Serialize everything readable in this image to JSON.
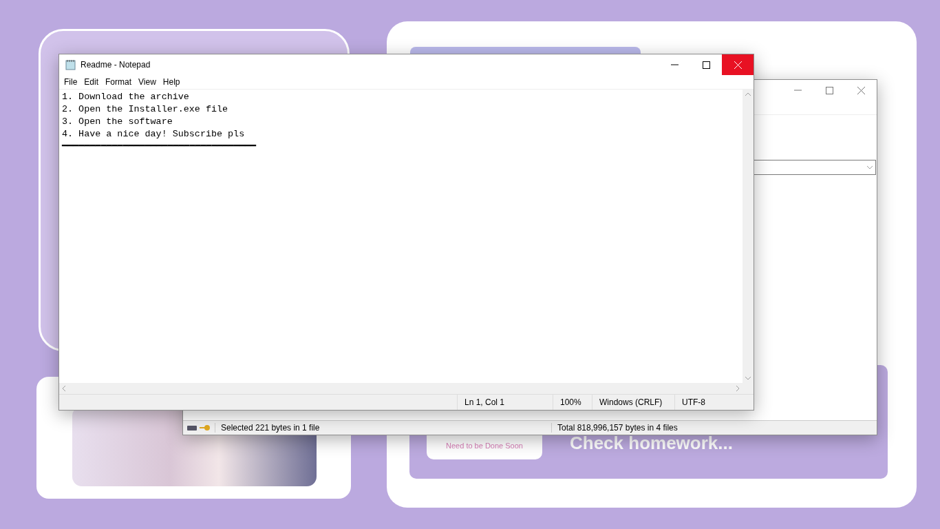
{
  "background_page": {
    "task_card": {
      "subtitle": "Need to be Done Soon"
    },
    "banner_text": "Check homework..."
  },
  "file_manager": {
    "status_selected": "Selected 221 bytes in 1 file",
    "status_total": "Total 818,996,157 bytes in 4 files"
  },
  "notepad": {
    "title": "Readme - Notepad",
    "menu": [
      "File",
      "Edit",
      "Format",
      "View",
      "Help"
    ],
    "lines": [
      "1. Download the archive",
      "2. Open the Installer.exe file",
      "3. Open the software",
      "4. Have a nice day! Subscribe pls",
      "━━━━━━━━━━━━━━━━━━━━━━━━━━━━━━━━━━━"
    ],
    "status": {
      "position": "Ln 1, Col 1",
      "zoom": "100%",
      "line_ending": "Windows (CRLF)",
      "encoding": "UTF-8"
    }
  }
}
